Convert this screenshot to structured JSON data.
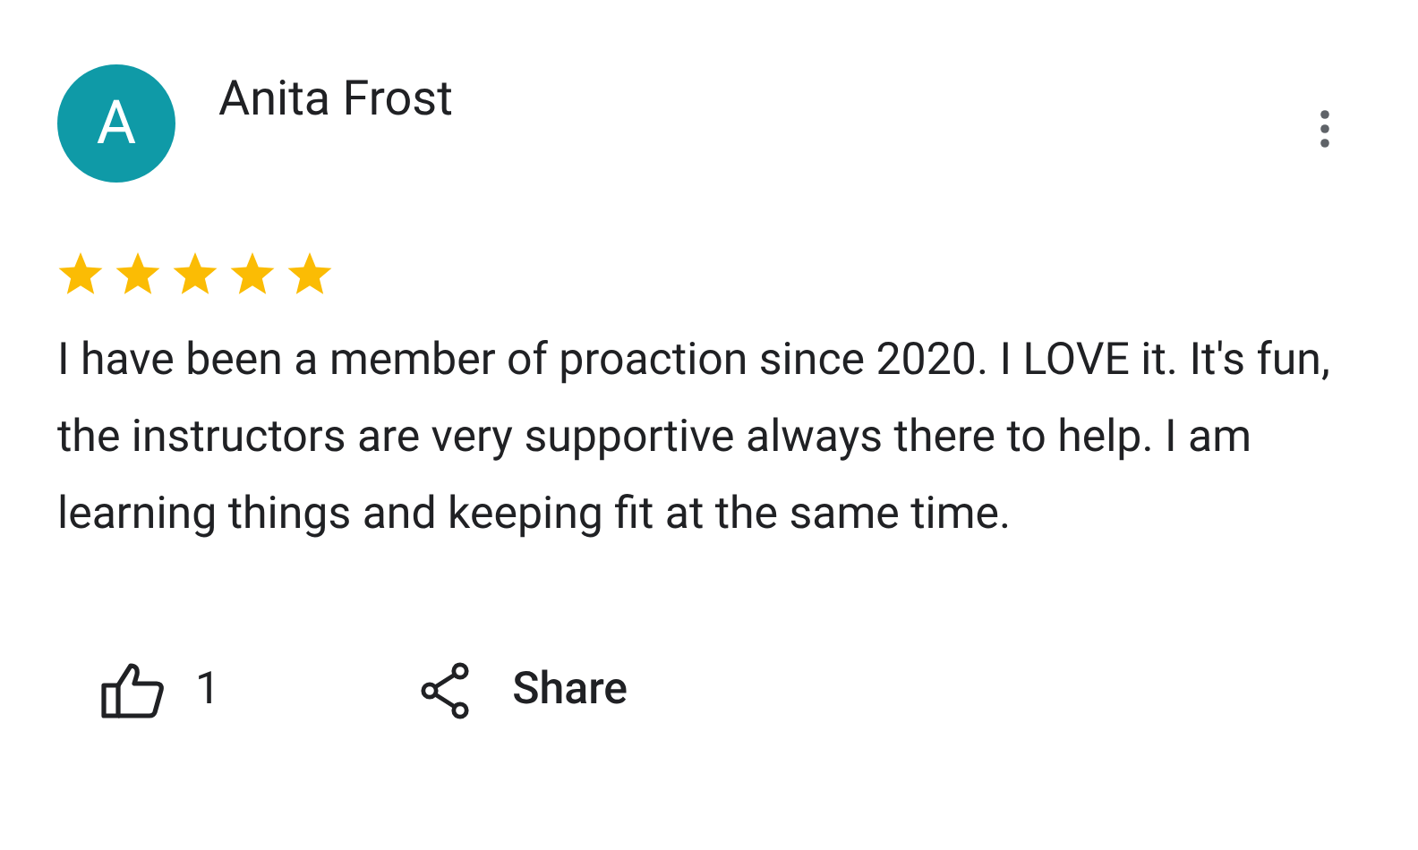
{
  "review": {
    "avatar_letter": "A",
    "author": "Anita Frost",
    "stars": 5,
    "text": "I have been a member of proaction since 2020. I LOVE it. It's fun, the instructors are very supportive always there to help. I am learning things and keeping fit at the same time."
  },
  "actions": {
    "like_count": "1",
    "share_label": "Share"
  }
}
